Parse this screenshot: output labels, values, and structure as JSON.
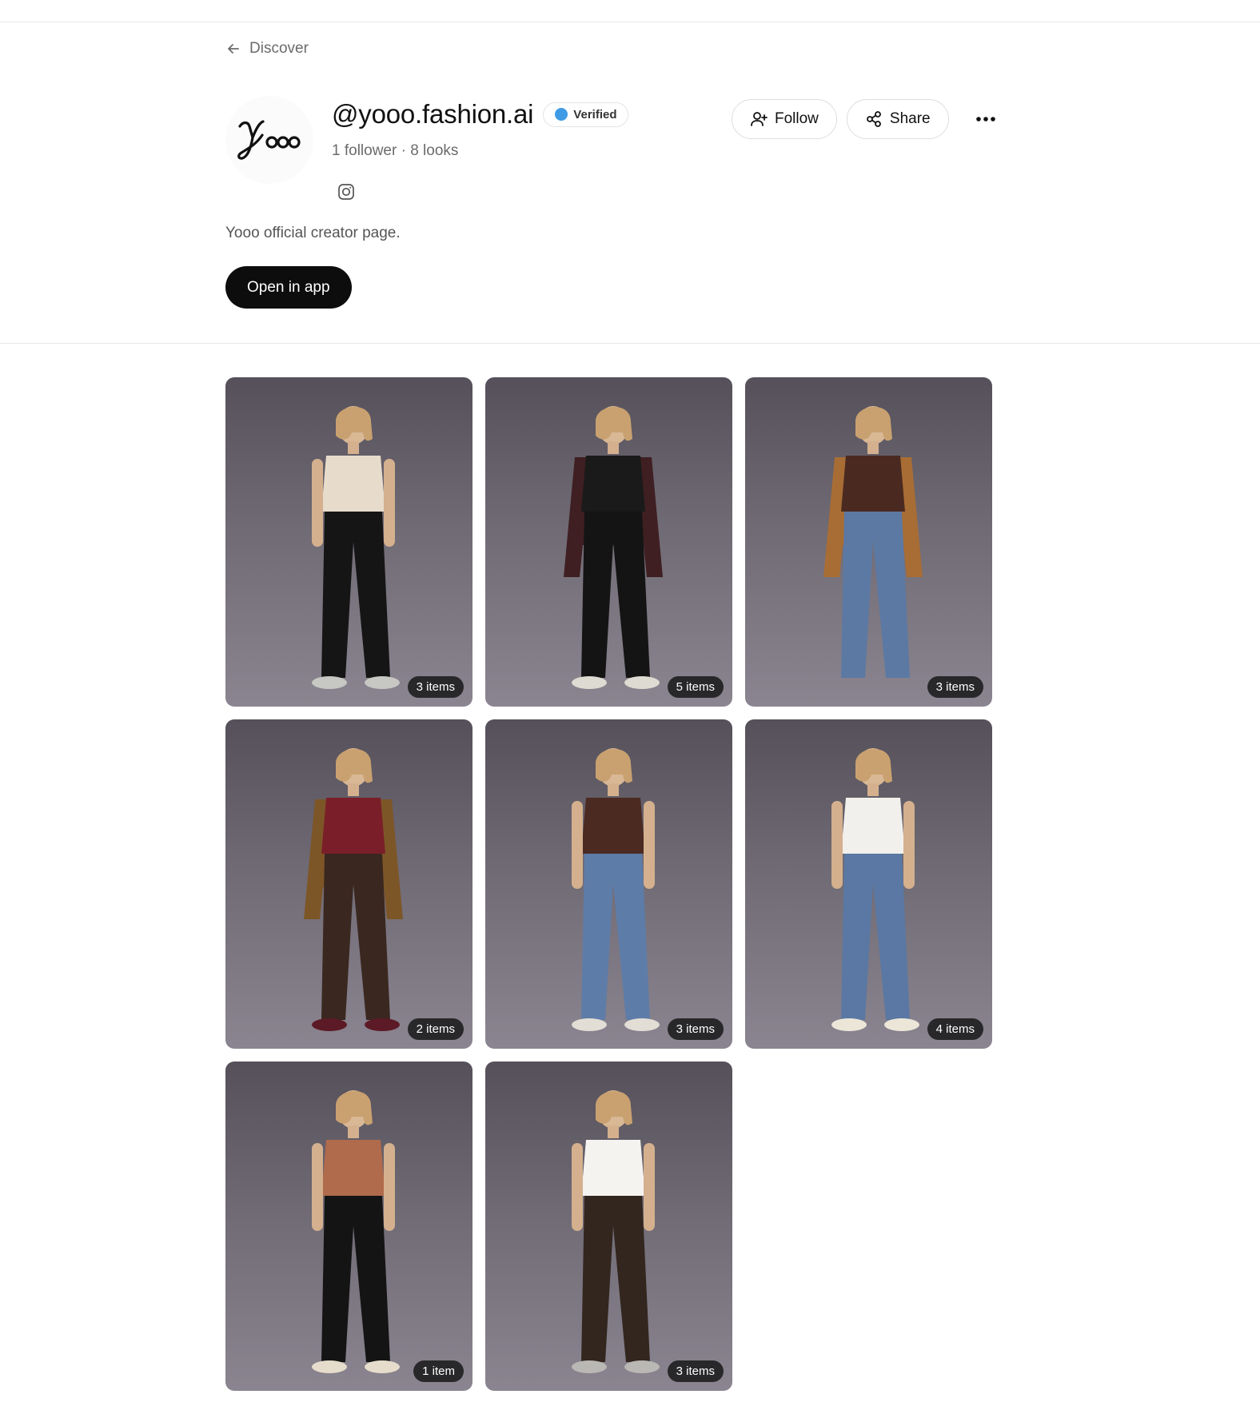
{
  "nav": {
    "back_label": "Discover"
  },
  "profile": {
    "handle": "@yooo.fashion.ai",
    "verified_label": "Verified",
    "verified_color": "#3f9be6",
    "stats": "1 follower · 8 looks",
    "bio": "Yooo official creator page.",
    "logo_icon": "yooo-logo",
    "social_icon": "instagram-icon"
  },
  "actions": {
    "follow_label": "Follow",
    "share_label": "Share",
    "more_icon": "more-icon",
    "open_app_label": "Open in app"
  },
  "looks": [
    {
      "items_label": "3 items",
      "top": "#e7dccb",
      "bottom": "#151515",
      "shoes": "#c7c7c4",
      "jacket": ""
    },
    {
      "items_label": "5 items",
      "top": "#1a1a1a",
      "bottom": "#141414",
      "shoes": "#dedbd2",
      "jacket": "#3f1f22"
    },
    {
      "items_label": "3 items",
      "top": "#4a2a20",
      "bottom": "#5c79a3",
      "shoes": "",
      "jacket": "#a86d35"
    },
    {
      "items_label": "2 items",
      "top": "#7a1f2a",
      "bottom": "#3a2720",
      "shoes": "#5c1a26",
      "jacket": "#7d5628"
    },
    {
      "items_label": "3 items",
      "top": "#4b2a22",
      "bottom": "#5e7ca8",
      "shoes": "#e2ded6",
      "jacket": ""
    },
    {
      "items_label": "4 items",
      "top": "#f2f0ec",
      "bottom": "#5a78a3",
      "shoes": "#ece6d9",
      "jacket": ""
    },
    {
      "items_label": "1 item",
      "top": "#b06a4c",
      "bottom": "#141414",
      "shoes": "#e6dccb",
      "jacket": ""
    },
    {
      "items_label": "3 items",
      "top": "#f4f3f0",
      "bottom": "#33261f",
      "shoes": "#b9b8b4",
      "jacket": ""
    }
  ]
}
